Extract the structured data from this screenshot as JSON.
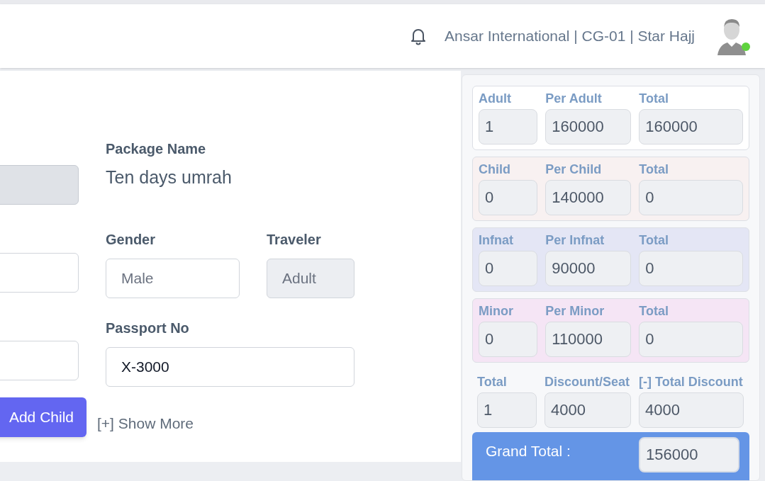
{
  "header": {
    "title": "Ansar International | CG-01 | Star Hajj",
    "online": true
  },
  "form": {
    "package_label": "Package Name",
    "package_name": "Ten days umrah",
    "gender": {
      "label": "Gender",
      "value": "Male"
    },
    "traveler": {
      "label": "Traveler",
      "value": "Adult",
      "disabled": true
    },
    "passport": {
      "label": "Passport No",
      "value": "X-3000"
    },
    "left_fields": [
      {
        "disabled": true
      },
      {
        "disabled": false
      },
      {
        "disabled": false
      }
    ],
    "add_button": "Add Child",
    "show_more": "[+] Show More"
  },
  "price_groups": [
    {
      "color": "#ffffff",
      "fields": [
        {
          "label": "Adult",
          "value": "1"
        },
        {
          "label": "Per Adult",
          "value": "160000"
        },
        {
          "label": "Total",
          "value": "160000"
        }
      ]
    },
    {
      "color": "#f8f1f1",
      "fields": [
        {
          "label": "Child",
          "value": "0"
        },
        {
          "label": "Per Child",
          "value": "140000"
        },
        {
          "label": "Total",
          "value": "0"
        }
      ]
    },
    {
      "color": "#e4e6f5",
      "fields": [
        {
          "label": "Infnat",
          "value": "0"
        },
        {
          "label": "Per Infnat",
          "value": "90000"
        },
        {
          "label": "Total",
          "value": "0"
        }
      ]
    },
    {
      "color": "#f5e5f5",
      "fields": [
        {
          "label": "Minor",
          "value": "0"
        },
        {
          "label": "Per Minor",
          "value": "110000"
        },
        {
          "label": "Total",
          "value": "0"
        }
      ]
    }
  ],
  "summary": [
    {
      "label": "Total",
      "value": "1"
    },
    {
      "label": "Discount/Seat",
      "value": "4000"
    },
    {
      "label": "[-] Total Discount",
      "value": "4000"
    }
  ],
  "grand_total": {
    "label": "Grand Total :",
    "value": "156000"
  }
}
